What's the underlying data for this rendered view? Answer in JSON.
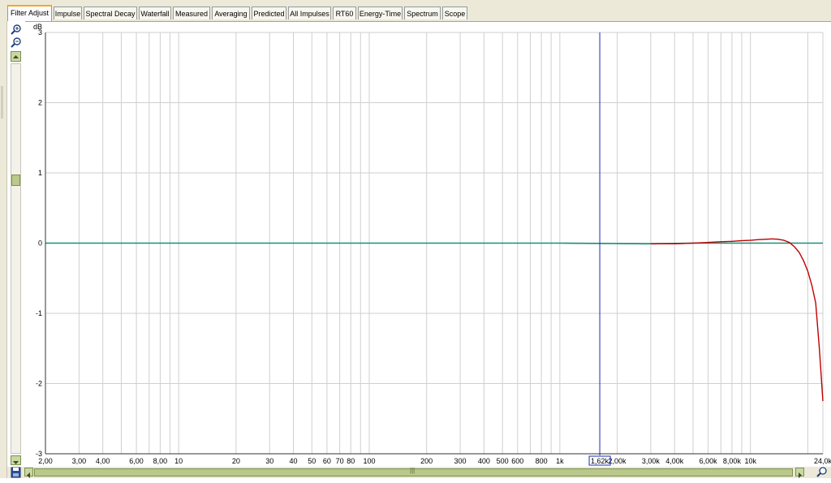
{
  "tabs": [
    {
      "label": "Filter Adjust",
      "active": true
    },
    {
      "label": "Impulse"
    },
    {
      "label": "Spectral Decay"
    },
    {
      "label": "Waterfall"
    },
    {
      "label": "Measured"
    },
    {
      "label": "Averaging"
    },
    {
      "label": "Predicted"
    },
    {
      "label": "All Impulses"
    },
    {
      "label": "RT60"
    },
    {
      "label": "Energy-Time"
    },
    {
      "label": "Spectrum"
    },
    {
      "label": "Scope"
    }
  ],
  "tools": [
    "zoom-in-icon",
    "zoom-out-icon",
    "scroll-up-icon"
  ],
  "hscroll_grip": "|||",
  "cursor_readout": "1,62k",
  "colors": {
    "grid": "#cfcfcf",
    "teal_trace": "#1c8c7d",
    "red_trace": "#c00000",
    "cursor": "#1a2db5",
    "tab_accent": "#f6a823"
  },
  "chart_data": {
    "type": "line",
    "title": "",
    "ylabel": "dB",
    "xlabel": "",
    "x_scale": "log",
    "xlim": [
      2.0,
      24000
    ],
    "ylim": [
      -3,
      3
    ],
    "grid": true,
    "y_ticks": [
      "3",
      "2",
      "1",
      "0",
      "-1",
      "-2",
      "-3"
    ],
    "x_ticks": [
      {
        "v": 2,
        "t": "2,00"
      },
      {
        "v": 3,
        "t": "3,00"
      },
      {
        "v": 4,
        "t": "4,00"
      },
      {
        "v": 6,
        "t": "6,00"
      },
      {
        "v": 8,
        "t": "8,00"
      },
      {
        "v": 10,
        "t": "10"
      },
      {
        "v": 20,
        "t": "20"
      },
      {
        "v": 30,
        "t": "30"
      },
      {
        "v": 40,
        "t": "40"
      },
      {
        "v": 50,
        "t": "50"
      },
      {
        "v": 60,
        "t": "60"
      },
      {
        "v": 70,
        "t": "70"
      },
      {
        "v": 80,
        "t": "80"
      },
      {
        "v": 100,
        "t": "100"
      },
      {
        "v": 200,
        "t": "200"
      },
      {
        "v": 300,
        "t": "300"
      },
      {
        "v": 400,
        "t": "400"
      },
      {
        "v": 500,
        "t": "500"
      },
      {
        "v": 600,
        "t": "600"
      },
      {
        "v": 800,
        "t": "800"
      },
      {
        "v": 1000,
        "t": "1k"
      },
      {
        "v": 2000,
        "t": "2,00k"
      },
      {
        "v": 3000,
        "t": "3,00k"
      },
      {
        "v": 4000,
        "t": "4,00k"
      },
      {
        "v": 6000,
        "t": "6,00k"
      },
      {
        "v": 8000,
        "t": "8,00k"
      },
      {
        "v": 10000,
        "t": "10k"
      },
      {
        "v": 24000,
        "t": "24,0k"
      }
    ],
    "cursor_freq": 1620,
    "series": [
      {
        "color": "#1c8c7d",
        "width": 1.6,
        "points": [
          [
            2,
            0
          ],
          [
            1000,
            0
          ],
          [
            3000,
            -0.01
          ],
          [
            5000,
            0
          ],
          [
            24000,
            0
          ]
        ]
      },
      {
        "color": "#c00000",
        "width": 1.4,
        "points": [
          [
            3000,
            -0.01
          ],
          [
            4000,
            -0.01
          ],
          [
            5000,
            0
          ],
          [
            6000,
            0.01
          ],
          [
            7000,
            0.02
          ],
          [
            8000,
            0.025
          ],
          [
            9000,
            0.035
          ],
          [
            10000,
            0.04
          ],
          [
            11000,
            0.05
          ],
          [
            12000,
            0.055
          ],
          [
            13000,
            0.06
          ],
          [
            14000,
            0.055
          ],
          [
            15000,
            0.04
          ],
          [
            16000,
            0.01
          ],
          [
            17000,
            -0.05
          ],
          [
            18000,
            -0.13
          ],
          [
            19000,
            -0.25
          ],
          [
            20000,
            -0.4
          ],
          [
            21000,
            -0.6
          ],
          [
            22000,
            -0.85
          ],
          [
            23000,
            -1.5
          ],
          [
            24000,
            -2.25
          ]
        ]
      }
    ]
  }
}
